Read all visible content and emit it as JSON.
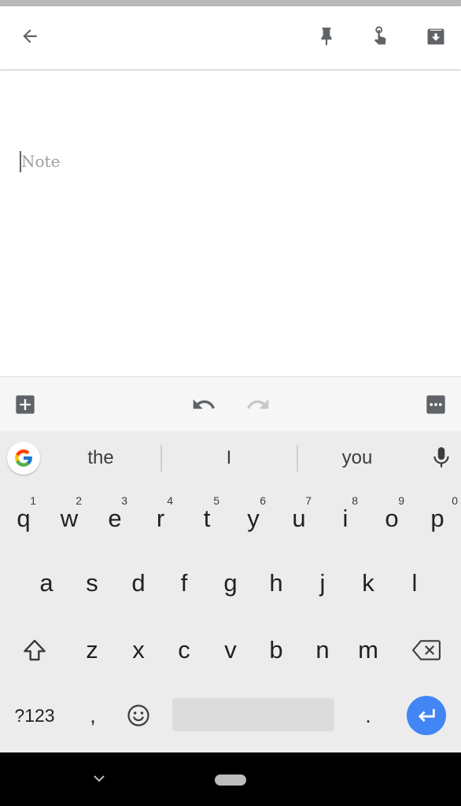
{
  "note": {
    "placeholder": "Note"
  },
  "suggestions": [
    "the",
    "I",
    "you"
  ],
  "keyboard": {
    "row1": [
      {
        "key": "q",
        "num": "1"
      },
      {
        "key": "w",
        "num": "2"
      },
      {
        "key": "e",
        "num": "3"
      },
      {
        "key": "r",
        "num": "4"
      },
      {
        "key": "t",
        "num": "5"
      },
      {
        "key": "y",
        "num": "6"
      },
      {
        "key": "u",
        "num": "7"
      },
      {
        "key": "i",
        "num": "8"
      },
      {
        "key": "o",
        "num": "9"
      },
      {
        "key": "p",
        "num": "0"
      }
    ],
    "row2": [
      "a",
      "s",
      "d",
      "f",
      "g",
      "h",
      "j",
      "k",
      "l"
    ],
    "row3": [
      "z",
      "x",
      "c",
      "v",
      "b",
      "n",
      "m"
    ],
    "symbols_label": "?123",
    "comma": ",",
    "period": "."
  },
  "icons": {
    "back": "arrow-back-icon",
    "pin": "pin-icon",
    "reminder": "reminder-finger-icon",
    "archive": "archive-icon",
    "add": "add-box-icon",
    "undo": "undo-icon",
    "redo": "redo-icon",
    "more": "more-options-icon",
    "google": "google-g-icon",
    "mic": "microphone-icon",
    "shift": "shift-icon",
    "backspace": "backspace-icon",
    "emoji": "emoji-icon",
    "enter": "enter-icon"
  },
  "colors": {
    "accent": "#4285f4",
    "navbar": "#000000"
  }
}
